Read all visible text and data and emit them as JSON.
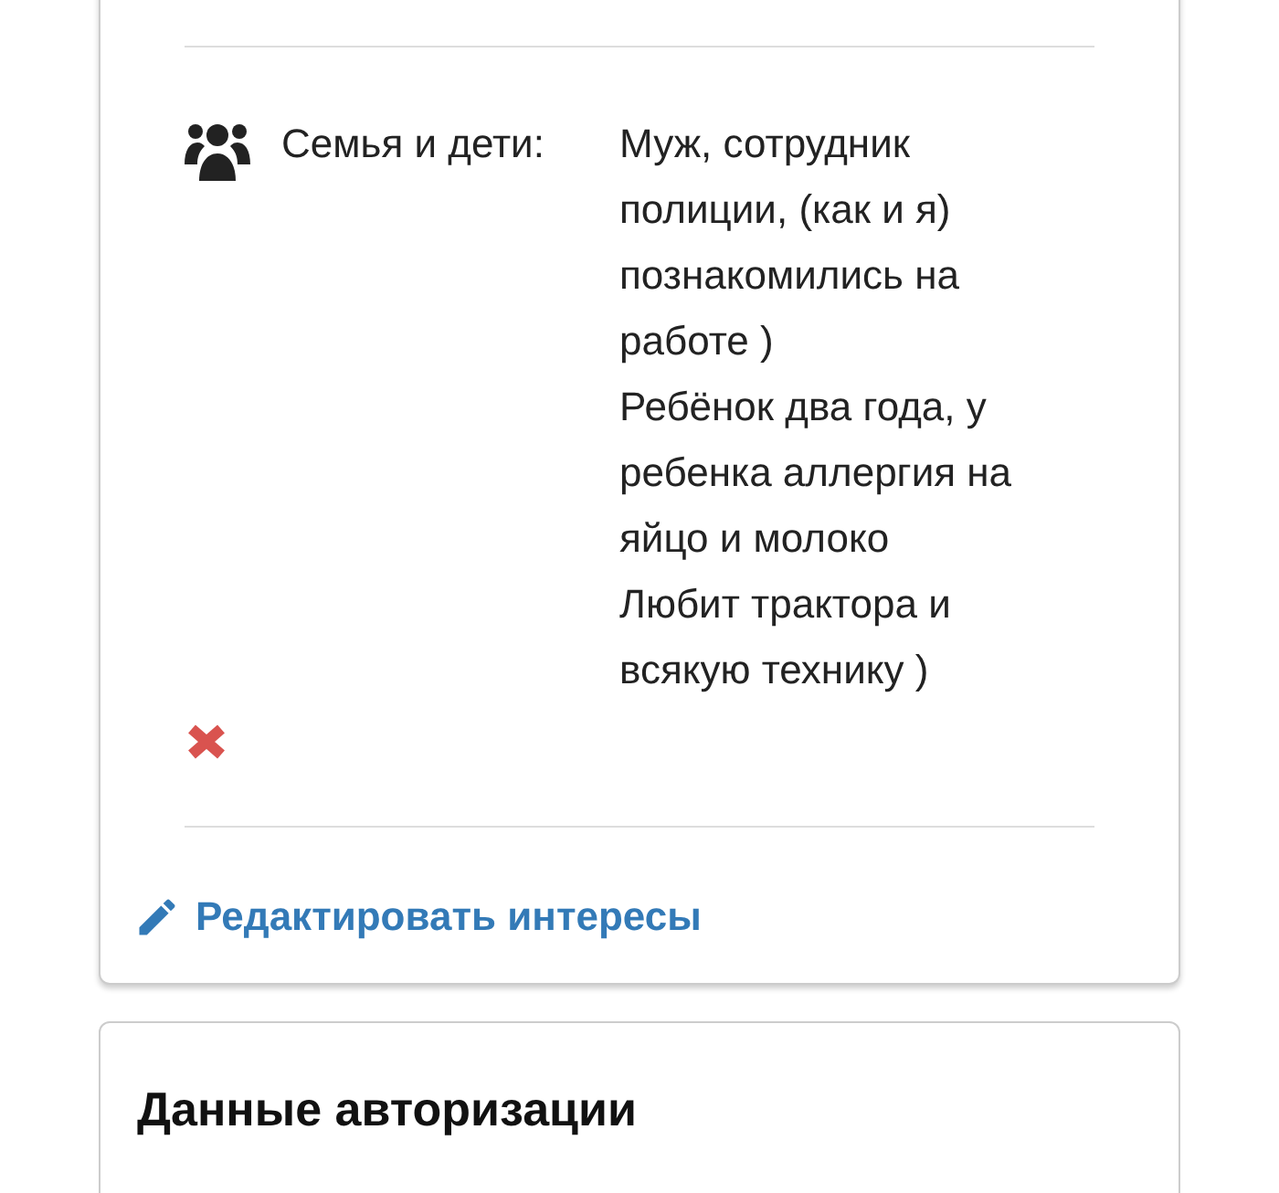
{
  "interests": [
    {
      "label": "Семья и дети:",
      "value": "Муж, сотрудник полиции, (как и я) познакомились на работе )\nРебёнок два года, у ребенка аллергия на яйцо и молоко\nЛюбит трактора и всякую технику )"
    }
  ],
  "edit_link": "Редактировать интересы",
  "auth_card": {
    "title": "Данные авторизации"
  }
}
